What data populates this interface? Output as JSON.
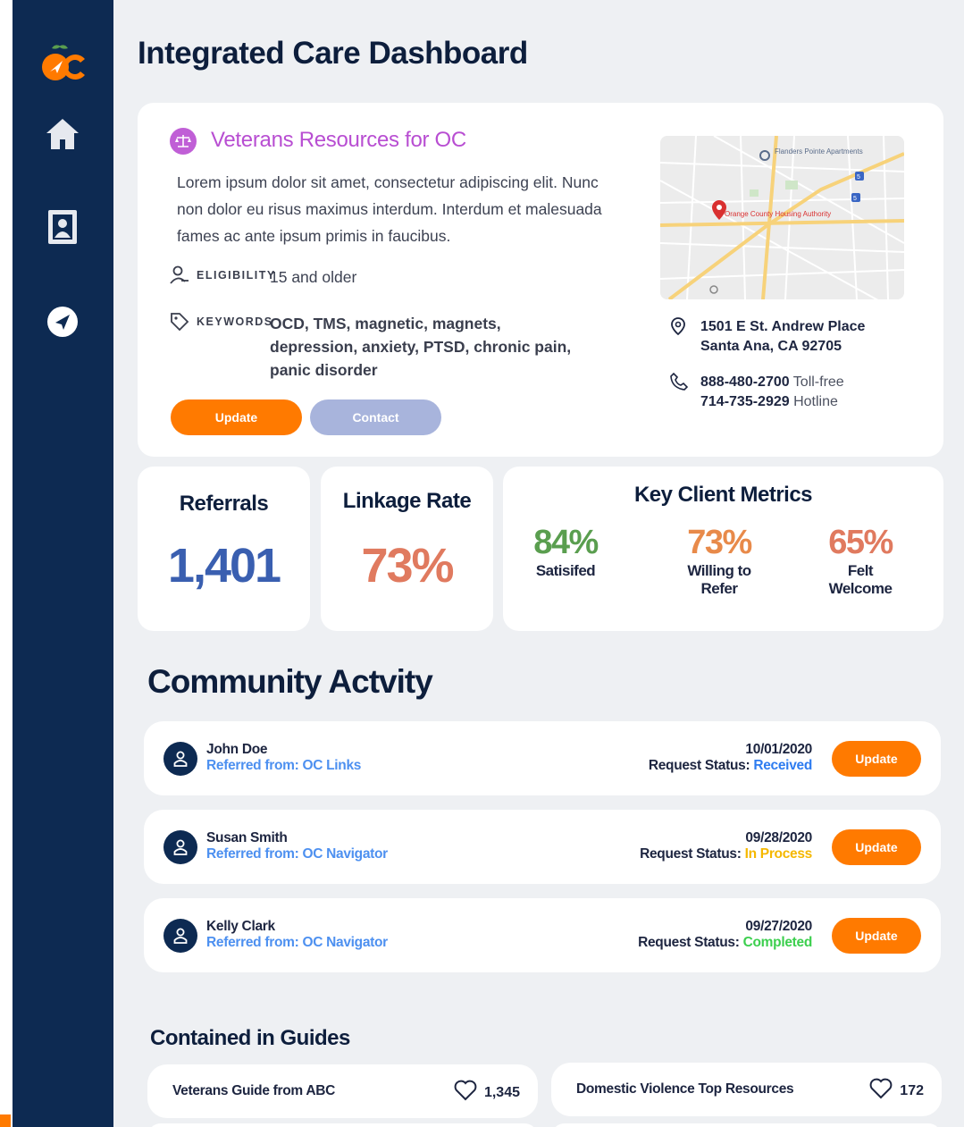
{
  "app": {
    "title": "Integrated Care Dashboard",
    "logo_text": "OC"
  },
  "sidebar": {
    "items": [
      {
        "icon": "home-icon"
      },
      {
        "icon": "contacts-icon"
      },
      {
        "icon": "navigation-icon"
      }
    ]
  },
  "resource": {
    "title": "Veterans Resources for OC",
    "description": "Lorem ipsum dolor sit amet, consectetur adipiscing elit. Nunc non dolor eu risus maximus interdum. Interdum et malesuada fames ac ante ipsum primis in faucibus.",
    "eligibility_label": "ELIGIBILITY",
    "eligibility_value": "15 and older",
    "keywords_label": "KEYWORDS",
    "keywords_value": "OCD, TMS, magnetic, magnets, depression, anxiety, PTSD, chronic pain, panic disorder",
    "update_label": "Update",
    "contact_label": "Contact",
    "map": {
      "place_1": "Flanders Pointe Apartments",
      "place_2": "Orange County Housing Authority",
      "highway_1": "5",
      "highway_2": "5"
    },
    "address_line_1": "1501 E St. Andrew Place",
    "address_line_2": "Santa Ana, CA 92705",
    "phone_1": "888-480-2700",
    "phone_1_note": "Toll-free",
    "phone_2": "714-735-2929",
    "phone_2_note": "Hotline"
  },
  "stats": {
    "referrals_label": "Referrals",
    "referrals_value": "1,401",
    "linkage_label": "Linkage Rate",
    "linkage_value": "73%",
    "key_metrics_title": "Key Client Metrics",
    "metrics": [
      {
        "value": "84%",
        "label": "Satisifed",
        "color": "#5a9e4f"
      },
      {
        "value": "73%",
        "label": "Willing to Refer",
        "color": "#e88a4a"
      },
      {
        "value": "65%",
        "label": "Felt Welcome",
        "color": "#e07a5f"
      }
    ],
    "referrals_color": "#3a5fb0",
    "linkage_color": "#e07a5f"
  },
  "community": {
    "title": "Community Actvity",
    "status_prefix": "Request Status:",
    "update_label": "Update",
    "rows": [
      {
        "name": "John Doe",
        "referred": "Referred from: OC Links",
        "date": "10/01/2020",
        "status": "Received",
        "status_color": "#2e7cf0"
      },
      {
        "name": "Susan Smith",
        "referred": "Referred from: OC Navigator",
        "date": "09/28/2020",
        "status": "In Process",
        "status_color": "#f5b800"
      },
      {
        "name": "Kelly Clark",
        "referred": "Referred from: OC Navigator",
        "date": "09/27/2020",
        "status": "Completed",
        "status_color": "#3ccf4e"
      }
    ]
  },
  "guides": {
    "title": "Contained in Guides",
    "items": [
      {
        "name": "Veterans Guide from ABC",
        "likes": "1,345"
      },
      {
        "name": "Domestic Violence Top Resources",
        "likes": "172"
      }
    ]
  },
  "colors": {
    "accent": "#ff7a00",
    "sidebar": "#0d2a52",
    "resource_title": "#b84ed2",
    "link_blue": "#4d90f0"
  }
}
